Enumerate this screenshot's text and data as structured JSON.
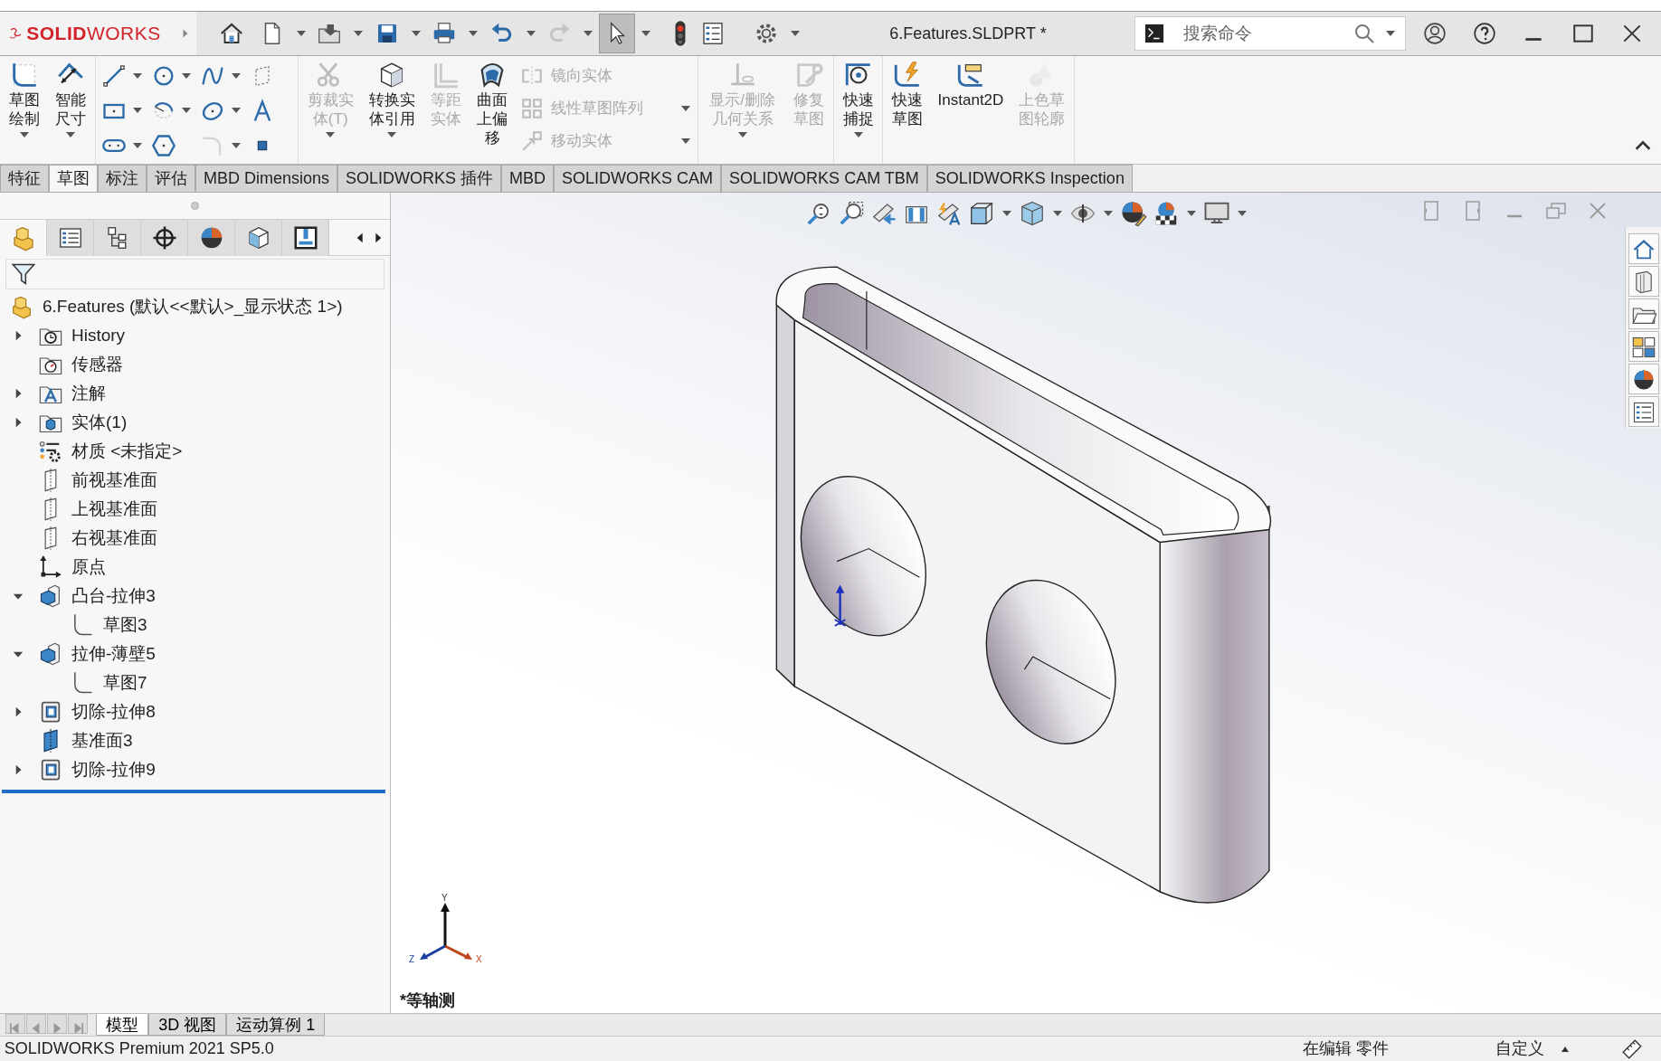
{
  "title_bar": {
    "logo": "**SOLID**WORKS",
    "document_title": "6.Features.SLDPRT *",
    "search": {
      "placeholder": "搜索命令"
    }
  },
  "quick_access": [
    {
      "kind": "home",
      "dropdown": false,
      "disabled": false,
      "selected": false
    },
    {
      "kind": "new",
      "dropdown": true,
      "disabled": false,
      "selected": false
    },
    {
      "kind": "open",
      "dropdown": true,
      "disabled": false,
      "selected": false
    },
    {
      "kind": "save",
      "dropdown": true,
      "disabled": false,
      "selected": false
    },
    {
      "kind": "print",
      "dropdown": true,
      "disabled": false,
      "selected": false
    },
    {
      "kind": "undo",
      "dropdown": true,
      "disabled": false,
      "selected": false
    },
    {
      "kind": "redo",
      "dropdown": true,
      "disabled": true,
      "selected": false
    },
    {
      "kind": "select",
      "dropdown": true,
      "disabled": false,
      "selected": true
    },
    {
      "kind": "rebuild",
      "dropdown": false,
      "disabled": false,
      "selected": false
    },
    {
      "kind": "properties",
      "dropdown": false,
      "disabled": false,
      "selected": false
    },
    {
      "kind": "options",
      "dropdown": true,
      "disabled": false,
      "selected": false
    }
  ],
  "ribbon": {
    "groups": [
      {
        "sections": [
          {
            "kind": "large",
            "commands": [
              {
                "kind": "sketch",
                "label": "草图绘制",
                "dropdown": true,
                "disabled": false
              },
              {
                "kind": "smartdim",
                "label": "智能尺寸",
                "dropdown": true,
                "disabled": false
              }
            ]
          }
        ]
      },
      {
        "sections": [
          {
            "kind": "grid",
            "commands": [
              {
                "kind": "line",
                "dropdown": true,
                "disabled": false
              },
              {
                "kind": "circle",
                "dropdown": true,
                "disabled": false
              },
              {
                "kind": "spline",
                "dropdown": true,
                "disabled": false
              },
              {
                "kind": "plane",
                "dropdown": false,
                "disabled": false
              },
              {
                "kind": "rect",
                "dropdown": true,
                "disabled": false
              },
              {
                "kind": "arc",
                "dropdown": true,
                "disabled": false
              },
              {
                "kind": "ellipse",
                "dropdown": true,
                "disabled": false
              },
              {
                "kind": "text",
                "dropdown": false,
                "disabled": false
              },
              {
                "kind": "slot",
                "dropdown": true,
                "disabled": false
              },
              {
                "kind": "polygon",
                "dropdown": false,
                "disabled": false
              },
              {
                "kind": "fillet",
                "dropdown": true,
                "disabled": true
              },
              {
                "kind": "point",
                "dropdown": false,
                "disabled": false
              }
            ]
          }
        ]
      },
      {
        "sections": [
          {
            "kind": "large",
            "commands": [
              {
                "kind": "trim",
                "label": "剪裁实体(T)",
                "dropdown": true,
                "disabled": true
              },
              {
                "kind": "convert",
                "label": "转换实体引用",
                "dropdown": true,
                "disabled": false
              },
              {
                "kind": "offset",
                "label": "等距实体",
                "dropdown": false,
                "disabled": true
              },
              {
                "kind": "surfoffset",
                "label": "曲面上偏移",
                "dropdown": false,
                "disabled": false
              }
            ]
          },
          {
            "kind": "stack",
            "commands": [
              {
                "kind": "mirror",
                "label": "镜向实体",
                "dropdown": false,
                "disabled": true
              },
              {
                "kind": "pattern",
                "label": "线性草图阵列",
                "dropdown": true,
                "disabled": true
              },
              {
                "kind": "move",
                "label": "移动实体",
                "dropdown": true,
                "disabled": true
              }
            ]
          }
        ]
      },
      {
        "sections": [
          {
            "kind": "large",
            "commands": [
              {
                "kind": "relations",
                "label": "显示/删除几何关系",
                "dropdown": true,
                "disabled": true
              },
              {
                "kind": "repair",
                "label": "修复草图",
                "dropdown": false,
                "disabled": true
              }
            ]
          }
        ]
      },
      {
        "sections": [
          {
            "kind": "large",
            "commands": [
              {
                "kind": "quicksnap",
                "label": "快速捕捉",
                "dropdown": true,
                "disabled": false
              }
            ]
          }
        ]
      },
      {
        "sections": [
          {
            "kind": "large",
            "commands": [
              {
                "kind": "rapidsketch",
                "label": "快速草图",
                "dropdown": false,
                "disabled": false
              },
              {
                "kind": "instant2d",
                "label": "Instant2D",
                "dropdown": false,
                "disabled": false
              },
              {
                "kind": "shaded",
                "label": "上色草图轮廓",
                "dropdown": false,
                "disabled": true
              }
            ]
          }
        ]
      }
    ]
  },
  "command_tabs": [
    {
      "label": "特征",
      "selected": false
    },
    {
      "label": "草图",
      "selected": true
    },
    {
      "label": "标注",
      "selected": false
    },
    {
      "label": "评估",
      "selected": false
    },
    {
      "label": "MBD Dimensions",
      "selected": false
    },
    {
      "label": "SOLIDWORKS 插件",
      "selected": false
    },
    {
      "label": "MBD",
      "selected": false
    },
    {
      "label": "SOLIDWORKS CAM",
      "selected": false
    },
    {
      "label": "SOLIDWORKS CAM TBM",
      "selected": false
    },
    {
      "label": "SOLIDWORKS Inspection",
      "selected": false
    }
  ],
  "feature_manager": {
    "tabs": [
      {
        "kind": "featuretree",
        "selected": true
      },
      {
        "kind": "propertymgr",
        "selected": false
      },
      {
        "kind": "configmgr",
        "selected": false
      },
      {
        "kind": "dimxpert",
        "selected": false
      },
      {
        "kind": "display",
        "selected": false
      },
      {
        "kind": "camfeature",
        "selected": false
      },
      {
        "kind": "camoperation",
        "selected": false
      }
    ],
    "root": {
      "kind": "part",
      "label": "6.Features (默认<<默认>_显示状态 1>)"
    },
    "tree": [
      {
        "kind": "history",
        "label": "History",
        "expanded": false
      },
      {
        "kind": "sensor",
        "label": "传感器"
      },
      {
        "kind": "annotation",
        "label": "注解",
        "expanded": false
      },
      {
        "kind": "solid",
        "label": "实体(1)",
        "expanded": false
      },
      {
        "kind": "material",
        "label": "材质 <未指定>"
      },
      {
        "kind": "plane",
        "label": "前视基准面"
      },
      {
        "kind": "plane",
        "label": "上视基准面"
      },
      {
        "kind": "plane",
        "label": "右视基准面"
      },
      {
        "kind": "origin",
        "label": "原点"
      },
      {
        "kind": "boss",
        "label": "凸台-拉伸3",
        "expanded": true,
        "children": [
          {
            "kind": "sketch",
            "label": "草图3"
          }
        ]
      },
      {
        "kind": "boss",
        "label": "拉伸-薄壁5",
        "expanded": true,
        "children": [
          {
            "kind": "sketch",
            "label": "草图7"
          }
        ]
      },
      {
        "kind": "cut",
        "label": "切除-拉伸8",
        "expanded": false
      },
      {
        "kind": "refplane",
        "label": "基准面3"
      },
      {
        "kind": "cut",
        "label": "切除-拉伸9",
        "expanded": false
      }
    ]
  },
  "viewport": {
    "heads_up_toolbar": [
      {
        "kind": "zoomfit",
        "dropdown": false
      },
      {
        "kind": "zoomarea",
        "dropdown": false
      },
      {
        "kind": "prevview",
        "dropdown": false
      },
      {
        "kind": "section",
        "dropdown": false
      },
      {
        "kind": "dynannot",
        "dropdown": false
      },
      {
        "kind": "vieworient",
        "dropdown": true
      },
      {
        "kind": "displaystyle",
        "dropdown": true
      },
      {
        "kind": "hideshow",
        "dropdown": true
      },
      {
        "kind": "appearance",
        "dropdown": false
      },
      {
        "kind": "scene",
        "dropdown": true
      },
      {
        "kind": "viewsettings",
        "dropdown": true
      }
    ],
    "view_label": "*等轴测",
    "triad": {
      "x": "X",
      "y": "Y",
      "z": "Z"
    },
    "task_pane": [
      {
        "kind": "tphome"
      },
      {
        "kind": "tpparts"
      },
      {
        "kind": "tpfolder"
      },
      {
        "kind": "tppalette"
      },
      {
        "kind": "tpappearance"
      },
      {
        "kind": "tpprops"
      }
    ]
  },
  "bottom_tabs": [
    {
      "label": "模型",
      "selected": true
    },
    {
      "label": "3D 视图",
      "selected": false
    },
    {
      "label": "运动算例 1",
      "selected": false
    }
  ],
  "status_bar": {
    "product": "SOLIDWORKS Premium 2021 SP5.0",
    "mode": "在编辑 零件",
    "units": "自定义"
  }
}
